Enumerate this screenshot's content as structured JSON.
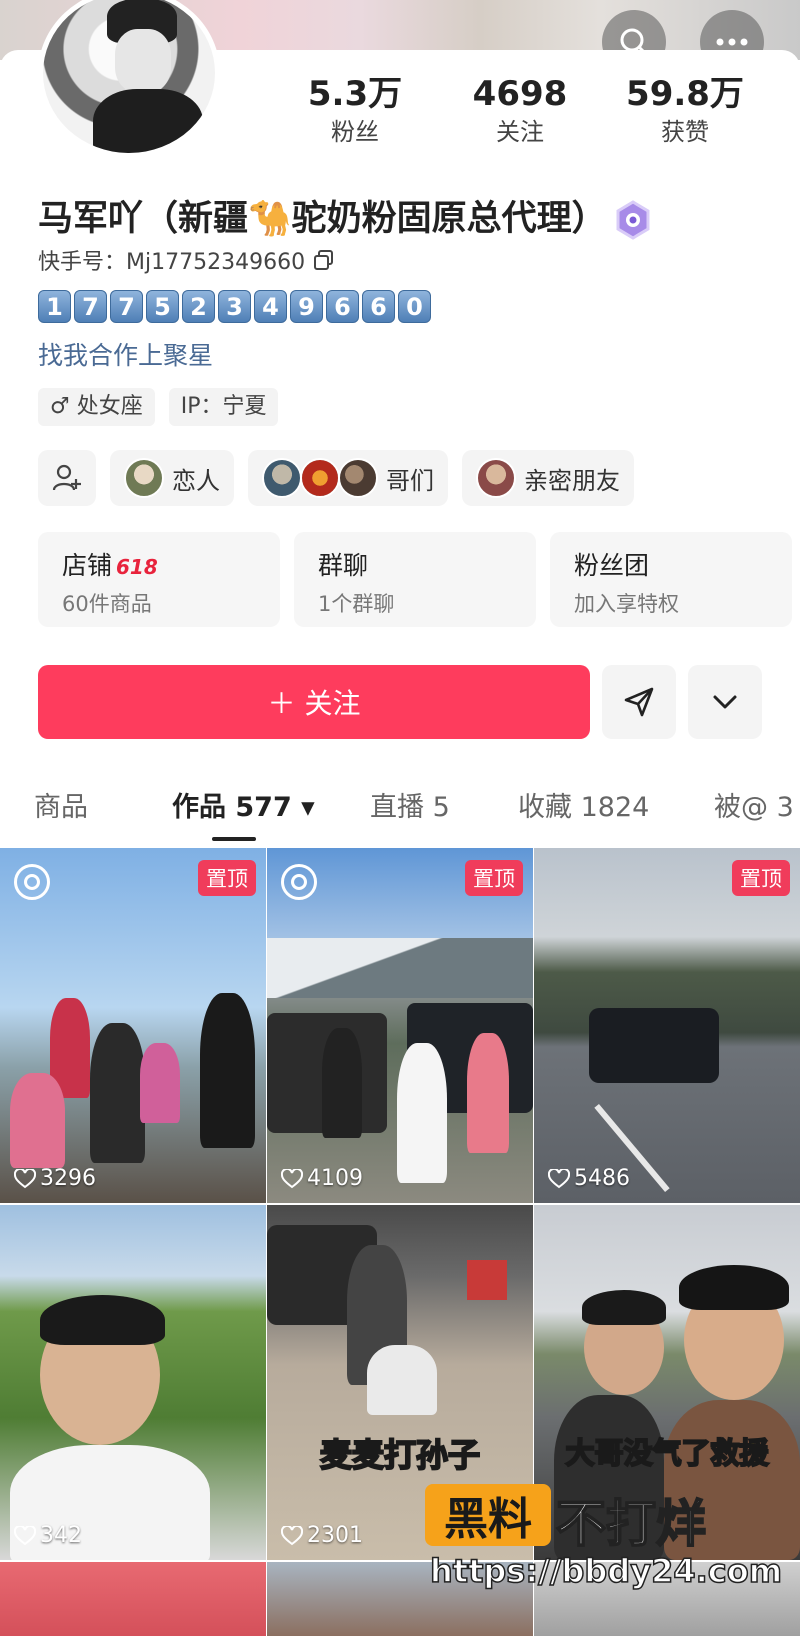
{
  "header": {
    "search_icon": "search-icon",
    "more_icon": "more-icon"
  },
  "stats": [
    {
      "value": "5.3万",
      "label": "粉丝"
    },
    {
      "value": "4698",
      "label": "关注"
    },
    {
      "value": "59.8万",
      "label": "获赞"
    }
  ],
  "profile": {
    "name": "马军吖（新疆🐪驼奶粉固原总代理）",
    "kuaishou_id": "快手号：Mj17752349660",
    "digits": [
      "1",
      "7",
      "7",
      "5",
      "2",
      "3",
      "4",
      "9",
      "6",
      "6",
      "0"
    ],
    "cooperation": "找我合作上聚星",
    "tags": [
      "♂ 处女座",
      "IP：宁夏"
    ]
  },
  "relations": {
    "add_icon": "add-friend-icon",
    "items": [
      {
        "label": "恋人"
      },
      {
        "label": "哥们"
      },
      {
        "label": "亲密朋友"
      }
    ]
  },
  "cards": [
    {
      "title": "店铺",
      "badge": "618",
      "sub": "60件商品"
    },
    {
      "title": "群聊",
      "badge": "",
      "sub": "1个群聊"
    },
    {
      "title": "粉丝团",
      "badge": "",
      "sub": "加入享特权"
    }
  ],
  "actions": {
    "follow_label": "＋ 关注",
    "accent": "#fe3c5d"
  },
  "tabs": [
    {
      "label": "商品"
    },
    {
      "label": "作品 577 ▾"
    },
    {
      "label": "直播 5"
    },
    {
      "label": "收藏 1824"
    },
    {
      "label": "被@ 3"
    }
  ],
  "videos": [
    {
      "likes": "3296",
      "pinned": "置顶",
      "caption": ""
    },
    {
      "likes": "4109",
      "pinned": "置顶",
      "caption": ""
    },
    {
      "likes": "5486",
      "pinned": "置顶",
      "caption": ""
    },
    {
      "likes": "342",
      "pinned": "",
      "caption": ""
    },
    {
      "likes": "2301",
      "pinned": "",
      "caption": "麦麦打孙子"
    },
    {
      "likes": "",
      "pinned": "",
      "caption": "大哥没气了救援"
    }
  ],
  "watermark": {
    "box": "黑料",
    "text": "不打烊",
    "url": "https://bbdy24.com"
  }
}
